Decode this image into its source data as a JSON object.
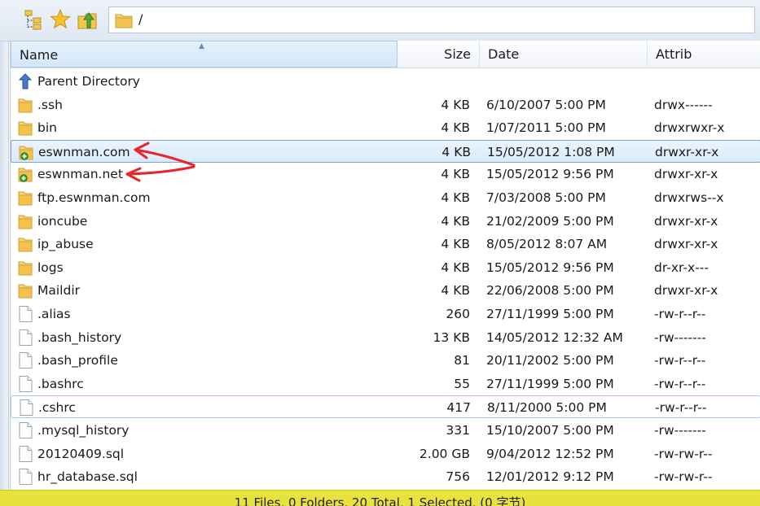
{
  "toolbar": {
    "icons": [
      "folder-tree-icon",
      "favorites-star-icon",
      "go-up-folder-icon"
    ],
    "path": "/"
  },
  "columns": {
    "name": "Name",
    "size": "Size",
    "date": "Date",
    "attrib": "Attrib"
  },
  "files": [
    {
      "name": "Parent Directory",
      "size": "",
      "date": "",
      "attrib": "",
      "icon": "parent-directory-icon"
    },
    {
      "name": ".ssh",
      "size": "4 KB",
      "date": "6/10/2007 5:00 PM",
      "attrib": "drwx------",
      "icon": "folder-icon"
    },
    {
      "name": "bin",
      "size": "4 KB",
      "date": "1/07/2011 5:00 PM",
      "attrib": "drwxrwxr-x",
      "icon": "folder-icon"
    },
    {
      "name": "eswnman.com",
      "size": "4 KB",
      "date": "15/05/2012 1:08 PM",
      "attrib": "drwxr-xr-x",
      "icon": "folder-new-icon",
      "selected": true
    },
    {
      "name": "eswnman.net",
      "size": "4 KB",
      "date": "15/05/2012 9:56 PM",
      "attrib": "drwxr-xr-x",
      "icon": "folder-new-icon"
    },
    {
      "name": "ftp.eswnman.com",
      "size": "4 KB",
      "date": "7/03/2008 5:00 PM",
      "attrib": "drwxrws--x",
      "icon": "folder-icon"
    },
    {
      "name": "ioncube",
      "size": "4 KB",
      "date": "21/02/2009 5:00 PM",
      "attrib": "drwxr-xr-x",
      "icon": "folder-icon"
    },
    {
      "name": "ip_abuse",
      "size": "4 KB",
      "date": "8/05/2012 8:07 AM",
      "attrib": "drwxr-xr-x",
      "icon": "folder-icon"
    },
    {
      "name": "logs",
      "size": "4 KB",
      "date": "15/05/2012 9:56 PM",
      "attrib": "dr-xr-x---",
      "icon": "folder-icon"
    },
    {
      "name": "Maildir",
      "size": "4 KB",
      "date": "22/06/2008 5:00 PM",
      "attrib": "drwxr-xr-x",
      "icon": "folder-icon"
    },
    {
      "name": ".alias",
      "size": "260",
      "date": "27/11/1999 5:00 PM",
      "attrib": "-rw-r--r--",
      "icon": "file-icon"
    },
    {
      "name": ".bash_history",
      "size": "13 KB",
      "date": "14/05/2012 12:32 AM",
      "attrib": "-rw-------",
      "icon": "file-icon"
    },
    {
      "name": ".bash_profile",
      "size": "81",
      "date": "20/11/2002 5:00 PM",
      "attrib": "-rw-r--r--",
      "icon": "file-icon"
    },
    {
      "name": ".bashrc",
      "size": "55",
      "date": "27/11/1999 5:00 PM",
      "attrib": "-rw-r--r--",
      "icon": "file-icon"
    },
    {
      "name": ".cshrc",
      "size": "417",
      "date": "8/11/2000 5:00 PM",
      "attrib": "-rw-r--r--",
      "icon": "file-icon",
      "focused": true
    },
    {
      "name": ".mysql_history",
      "size": "331",
      "date": "15/10/2007 5:00 PM",
      "attrib": "-rw-------",
      "icon": "file-icon"
    },
    {
      "name": "20120409.sql",
      "size": "2.00 GB",
      "date": "9/04/2012 12:52 PM",
      "attrib": "-rw-rw-r--",
      "icon": "file-icon"
    },
    {
      "name": "hr_database.sql",
      "size": "756",
      "date": "12/01/2012 9:12 PM",
      "attrib": "-rw-rw-r--",
      "icon": "file-icon"
    }
  ],
  "status": "11 Files, 0 Folders, 20 Total, 1 Selected, (0 字节)",
  "annotation_color": "#e8262a",
  "selection_color": "#d9ebfb",
  "status_bar_color": "#e8e23f"
}
